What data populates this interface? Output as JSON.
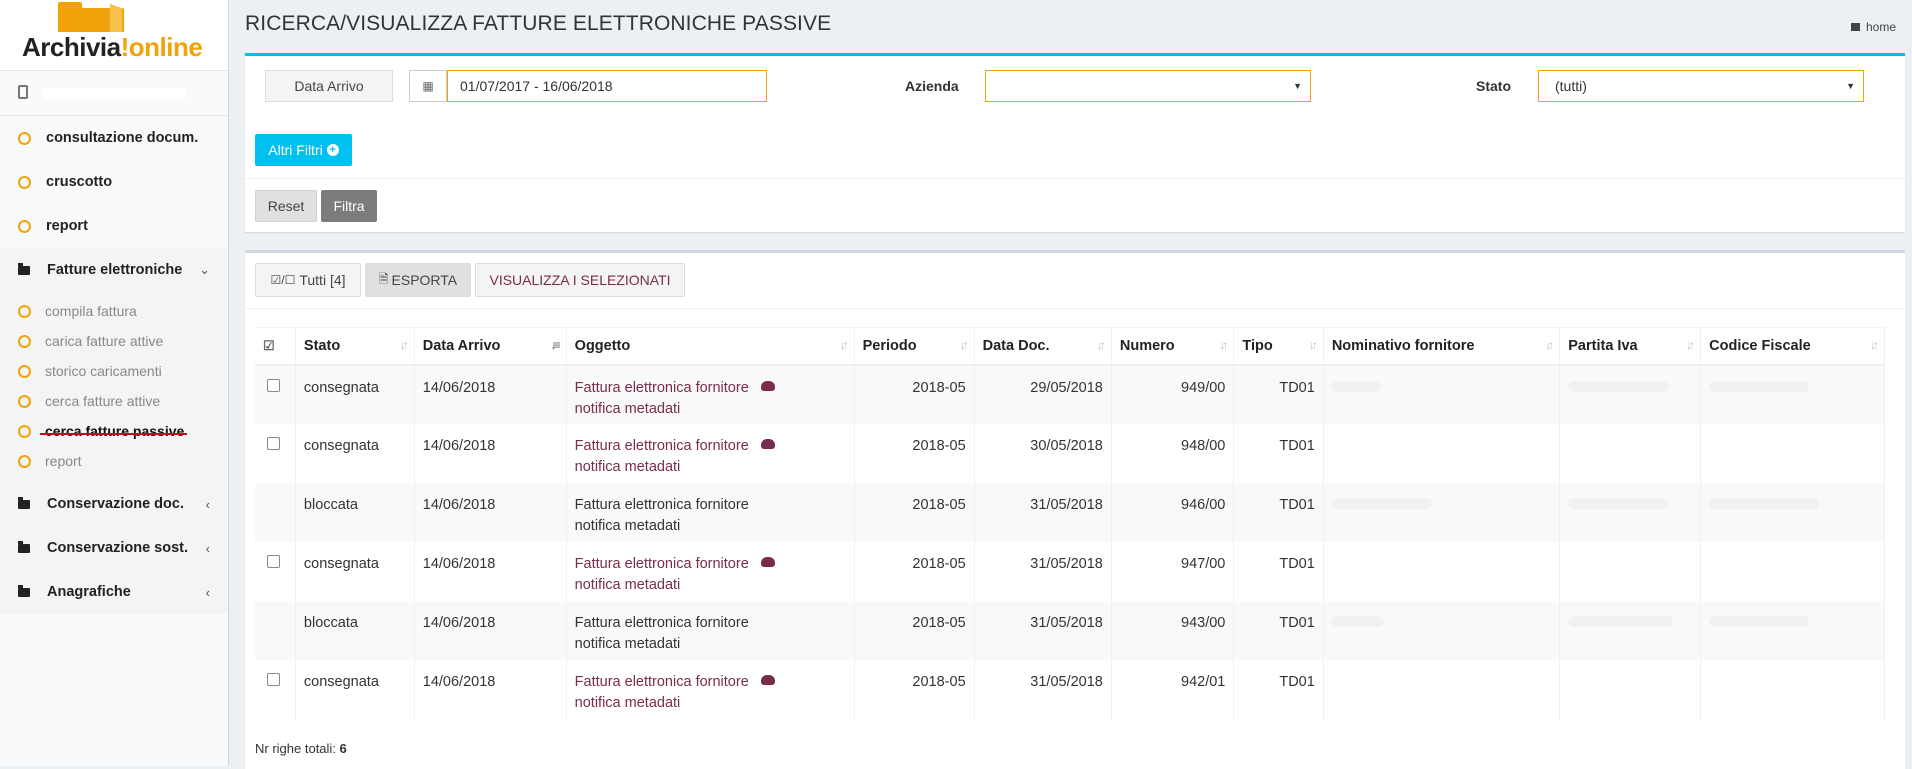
{
  "brand": {
    "name_part1": "Archivia",
    "name_part2": "online",
    "accent": "#f0a30a"
  },
  "sidebar": {
    "items": [
      {
        "label": "consultazione docum."
      },
      {
        "label": "cruscotto"
      },
      {
        "label": "report"
      }
    ],
    "fatture": {
      "label": "Fatture elettroniche",
      "sub": [
        {
          "label": "compila fattura"
        },
        {
          "label": "carica fatture attive"
        },
        {
          "label": "storico caricamenti"
        },
        {
          "label": "cerca fatture attive"
        },
        {
          "label": "cerca fatture passive"
        },
        {
          "label": "report"
        }
      ]
    },
    "sections": [
      {
        "label": "Conservazione doc."
      },
      {
        "label": "Conservazione sost."
      },
      {
        "label": "Anagrafiche"
      }
    ]
  },
  "header": {
    "title": "RICERCA/VISUALIZZA FATTURE ELETTRONICHE PASSIVE",
    "home": "home"
  },
  "filters": {
    "date_button": "Data Arrivo",
    "date_range": "01/07/2017 - 16/06/2018",
    "azienda_label": "Azienda",
    "azienda_value": "",
    "stato_label": "Stato",
    "stato_value": "(tutti)",
    "altri_filtri": "Altri Filtri",
    "reset": "Reset",
    "filtra": "Filtra"
  },
  "toolbar": {
    "tutti": "Tutti [4]",
    "esporta": "ESPORTA",
    "visualizza": "VISUALIZZA I SELEZIONATI"
  },
  "table": {
    "columns": [
      "Stato",
      "Data Arrivo",
      "Oggetto",
      "Periodo",
      "Data Doc.",
      "Numero",
      "Tipo",
      "Nominativo fornitore",
      "Partita Iva",
      "Codice Fiscale"
    ],
    "rows": [
      {
        "stato": "consegnata",
        "data_arrivo": "14/06/2018",
        "oggetto1": "Fattura elettronica fornitore",
        "oggetto2": "notifica metadati",
        "periodo": "2018-05",
        "data_doc": "29/05/2018",
        "numero": "949/00",
        "tipo": "TD01"
      },
      {
        "stato": "consegnata",
        "data_arrivo": "14/06/2018",
        "oggetto1": "Fattura elettronica fornitore",
        "oggetto2": "notifica metadati",
        "periodo": "2018-05",
        "data_doc": "30/05/2018",
        "numero": "948/00",
        "tipo": "TD01"
      },
      {
        "stato": "bloccata",
        "data_arrivo": "14/06/2018",
        "oggetto1": "Fattura elettronica fornitore",
        "oggetto2": "notifica metadati",
        "periodo": "2018-05",
        "data_doc": "31/05/2018",
        "numero": "946/00",
        "tipo": "TD01"
      },
      {
        "stato": "consegnata",
        "data_arrivo": "14/06/2018",
        "oggetto1": "Fattura elettronica fornitore",
        "oggetto2": "notifica metadati",
        "periodo": "2018-05",
        "data_doc": "31/05/2018",
        "numero": "947/00",
        "tipo": "TD01"
      },
      {
        "stato": "bloccata",
        "data_arrivo": "14/06/2018",
        "oggetto1": "Fattura elettronica fornitore",
        "oggetto2": "notifica metadati",
        "periodo": "2018-05",
        "data_doc": "31/05/2018",
        "numero": "943/00",
        "tipo": "TD01"
      },
      {
        "stato": "consegnata",
        "data_arrivo": "14/06/2018",
        "oggetto1": "Fattura elettronica fornitore",
        "oggetto2": "notifica metadati",
        "periodo": "2018-05",
        "data_doc": "31/05/2018",
        "numero": "942/01",
        "tipo": "TD01"
      }
    ],
    "footer_label": "Nr righe totali:",
    "footer_count": "6"
  }
}
